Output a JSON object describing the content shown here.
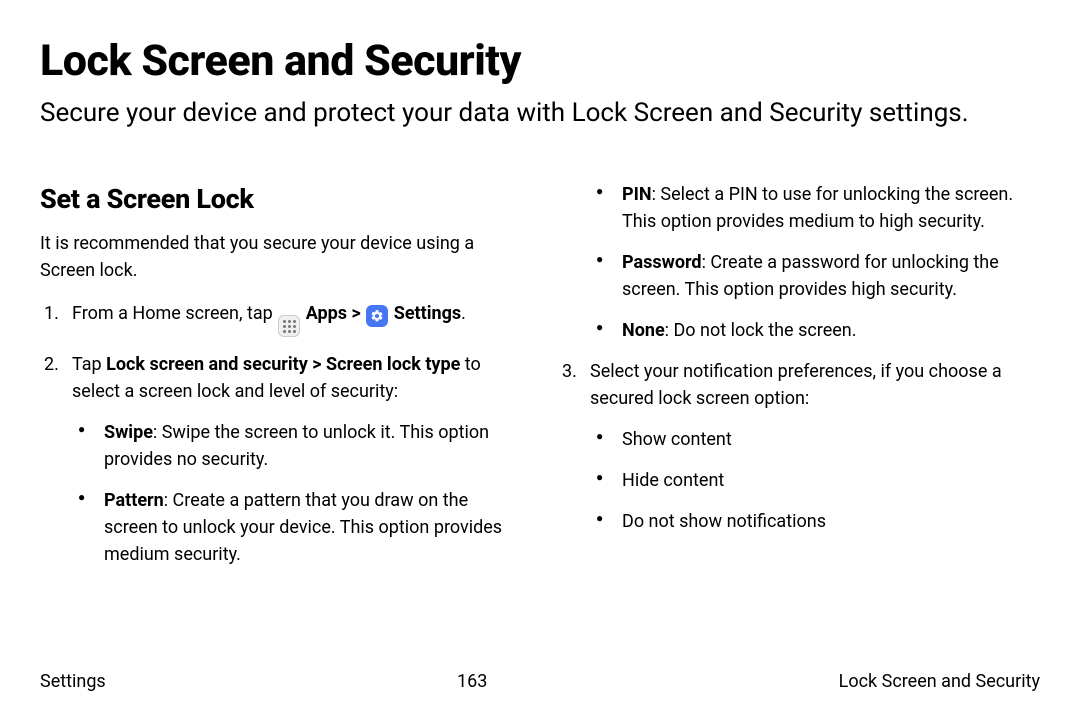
{
  "page": {
    "title": "Lock Screen and Security",
    "subtitle": "Secure your device and protect your data with Lock Screen and Security settings."
  },
  "section": {
    "heading": "Set a Screen Lock",
    "intro": "It is recommended that you secure your device using a Screen lock.",
    "step1_a": "From a Home screen, tap ",
    "step1_apps": "Apps",
    "step1_sep": " > ",
    "step1_settings": "Settings",
    "step1_end": ".",
    "step2_a": "Tap ",
    "step2_path": "Lock screen and security > Screen lock type",
    "step2_b": " to select a screen lock and level of security:",
    "bullets_lock": {
      "swipe_t": "Swipe",
      "swipe_b": ": Swipe the screen to unlock it. This option provides no security.",
      "pattern_t": "Pattern",
      "pattern_b": ": Create a pattern that you draw on the screen to unlock your device. This option provides medium security.",
      "pin_t": "PIN",
      "pin_b": ": Select a PIN to use for unlocking the screen. This option provides medium to high security.",
      "password_t": "Password",
      "password_b": ": Create a password for unlocking the screen. This option provides high security.",
      "none_t": "None",
      "none_b": ": Do not lock the screen."
    },
    "step3": "Select your notification preferences, if you choose a secured lock screen option:",
    "bullets_notify": {
      "a": "Show content",
      "b": "Hide content",
      "c": "Do not show notifications"
    }
  },
  "footer": {
    "left": "Settings",
    "page_num": "163",
    "right": "Lock Screen and Security"
  }
}
